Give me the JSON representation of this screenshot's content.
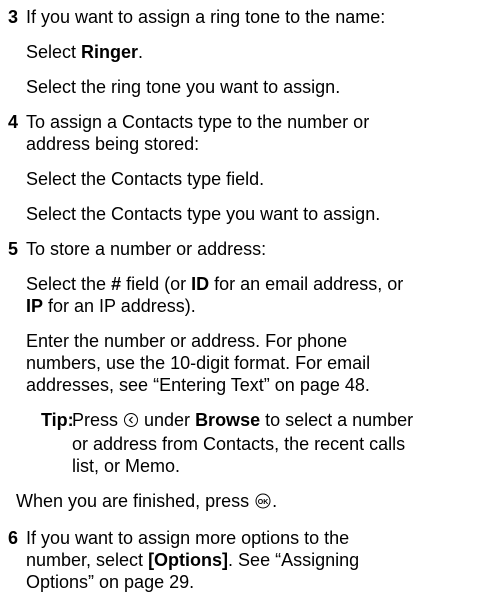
{
  "steps": [
    {
      "num": "3",
      "intro": "If you want to assign a ring tone to the name:",
      "a_pre": "Select ",
      "a_bold": "Ringer",
      "a_post": ".",
      "b": "Select the ring tone you want to assign."
    },
    {
      "num": "4",
      "intro_1": "To assign a Contacts type to the number or",
      "intro_2": "address being stored:",
      "a": "Select the Contacts type field.",
      "b": "Select the Contacts type you want to assign."
    },
    {
      "num": "5",
      "intro": "To store a number or address:",
      "a_1_pre": "Select the ",
      "a_1_b1": "#",
      "a_1_mid": " field (or ",
      "a_1_b2": "ID",
      "a_1_post": " for an email address, or",
      "a_2_b": "IP",
      "a_2_post": " for an IP address).",
      "b_1": "Enter the number or address. For phone",
      "b_2": "numbers, use the 10-digit format. For email",
      "b_3": "addresses, see “Entering Text” on page 48.",
      "tip_label": "Tip:",
      "tip_1_pre": " Press ",
      "tip_1_mid": " under ",
      "tip_1_b": "Browse",
      "tip_1_post": " to select a number",
      "tip_2": "or address from Contacts, the recent calls",
      "tip_3": "list, or Memo.",
      "c_pre": "When you are finished, press ",
      "c_post": "."
    },
    {
      "num": "6",
      "l1": "If you want to assign more options to the",
      "l2_pre": "number, select ",
      "l2_b": "[Options]",
      "l2_post": ". See “Assigning",
      "l3": "Options” on page 29."
    }
  ],
  "icons": {
    "nav_key": "left-nav-key-icon",
    "ok_key": "ok-key-icon"
  }
}
